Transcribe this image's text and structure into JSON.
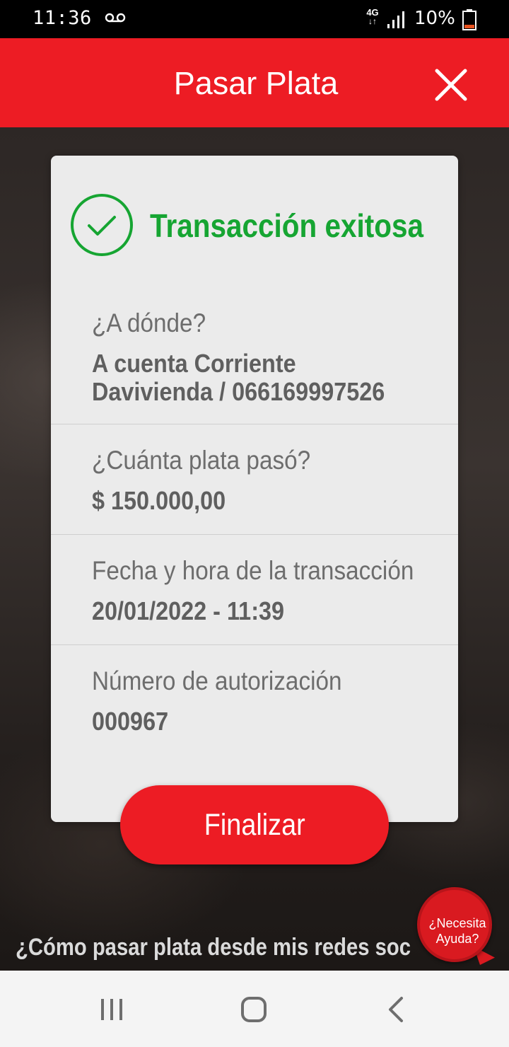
{
  "status_bar": {
    "time": "11:36",
    "network_type": "4G",
    "battery": "10%"
  },
  "header": {
    "title": "Pasar Plata"
  },
  "result": {
    "title": "Transacción exitosa",
    "color": "#16a532"
  },
  "details": [
    {
      "label": "¿A dónde?",
      "value_lines": [
        "A cuenta Corriente",
        "Davivienda / 066169997526"
      ]
    },
    {
      "label": "¿Cuánta plata pasó?",
      "value_lines": [
        "$ 150.000,00"
      ]
    },
    {
      "label": "Fecha y hora de la transacción",
      "value_lines": [
        "20/01/2022 - 11:39"
      ]
    },
    {
      "label": "Número de autorización",
      "value_lines": [
        "000967"
      ]
    }
  ],
  "actions": {
    "finalize_label": "Finalizar"
  },
  "footer": {
    "social_link": "¿Cómo pasar plata desde mis redes soc"
  },
  "help": {
    "line1": "¿Necesita",
    "line2": "Ayuda?"
  },
  "colors": {
    "brand_red": "#ed1c24",
    "success_green": "#16a532"
  }
}
